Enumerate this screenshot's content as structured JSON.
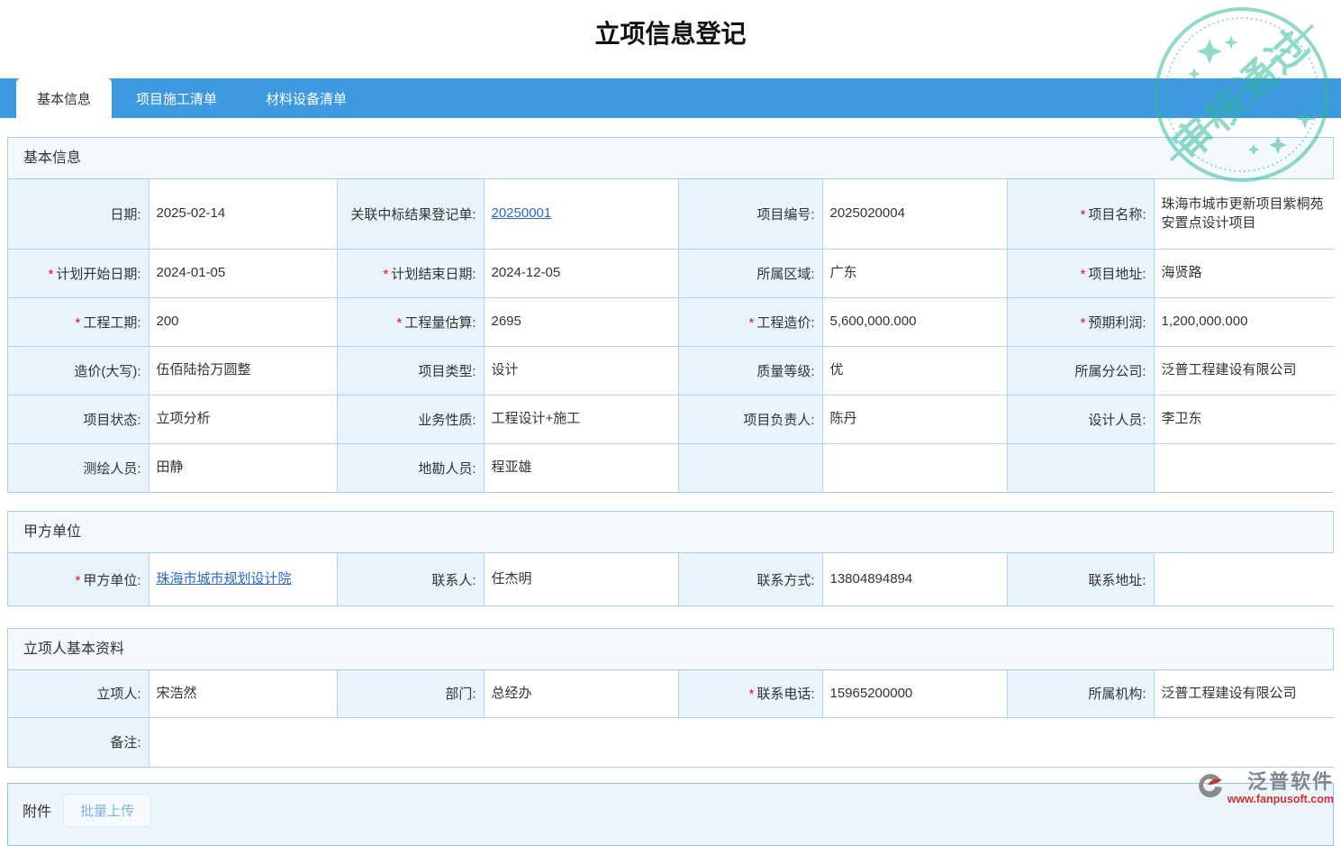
{
  "marks": {
    "required": "*"
  },
  "page": {
    "title": "立项信息登记"
  },
  "tabs": {
    "items": [
      {
        "label": "基本信息",
        "active": true
      },
      {
        "label": "项目施工清单",
        "active": false
      },
      {
        "label": "材料设备清单",
        "active": false
      }
    ]
  },
  "stamp": {
    "text": "审核通过",
    "color": "#2eb896"
  },
  "basic": {
    "title": "基本信息",
    "rows": [
      {
        "cells": [
          {
            "label": "日期:",
            "value": "2025-02-14"
          },
          {
            "label": "关联中标结果登记单:",
            "value": "20250001",
            "link": true
          },
          {
            "label": "项目编号:",
            "value": "2025020004"
          },
          {
            "label": "项目名称:",
            "value": "珠海市城市更新项目紫桐苑安置点设计项目",
            "required": true
          }
        ]
      },
      {
        "cells": [
          {
            "label": "计划开始日期:",
            "value": "2024-01-05",
            "required": true
          },
          {
            "label": "计划结束日期:",
            "value": "2024-12-05",
            "required": true
          },
          {
            "label": "所属区域:",
            "value": "广东"
          },
          {
            "label": "项目地址:",
            "value": "海贤路",
            "required": true
          }
        ]
      },
      {
        "cells": [
          {
            "label": "工程工期:",
            "value": "200",
            "required": true
          },
          {
            "label": "工程量估算:",
            "value": "2695",
            "required": true
          },
          {
            "label": "工程造价:",
            "value": "5,600,000.000",
            "required": true
          },
          {
            "label": "预期利润:",
            "value": "1,200,000.000",
            "required": true
          }
        ]
      },
      {
        "cells": [
          {
            "label": "造价(大写):",
            "value": "伍佰陆拾万圆整"
          },
          {
            "label": "项目类型:",
            "value": "设计"
          },
          {
            "label": "质量等级:",
            "value": "优"
          },
          {
            "label": "所属分公司:",
            "value": "泛普工程建设有限公司"
          }
        ]
      },
      {
        "cells": [
          {
            "label": "项目状态:",
            "value": "立项分析"
          },
          {
            "label": "业务性质:",
            "value": "工程设计+施工"
          },
          {
            "label": "项目负责人:",
            "value": "陈丹"
          },
          {
            "label": "设计人员:",
            "value": "李卫东"
          }
        ]
      },
      {
        "cells": [
          {
            "label": "测绘人员:",
            "value": "田静"
          },
          {
            "label": "地勘人员:",
            "value": "程亚雄"
          },
          {
            "label": "",
            "value": ""
          },
          {
            "label": "",
            "value": ""
          }
        ]
      }
    ]
  },
  "party_a": {
    "title": "甲方单位",
    "row": {
      "cells": [
        {
          "label": "甲方单位:",
          "value": "珠海市城市规划设计院",
          "required": true,
          "link": true
        },
        {
          "label": "联系人:",
          "value": "任杰明"
        },
        {
          "label": "联系方式:",
          "value": "13804894894"
        },
        {
          "label": "联系地址:",
          "value": ""
        }
      ]
    }
  },
  "initiator": {
    "title": "立项人基本资料",
    "row1": {
      "cells": [
        {
          "label": "立项人:",
          "value": "宋浩然"
        },
        {
          "label": "部门:",
          "value": "总经办"
        },
        {
          "label": "联系电话:",
          "value": "15965200000",
          "required": true
        },
        {
          "label": "所属机构:",
          "value": "泛普工程建设有限公司"
        }
      ]
    },
    "row2": {
      "label": "备注:",
      "value": ""
    }
  },
  "attachment": {
    "label": "附件",
    "upload_button": "批量上传"
  },
  "footer_logo": {
    "name": "泛普软件",
    "url": "www.fanpusoft.com"
  }
}
